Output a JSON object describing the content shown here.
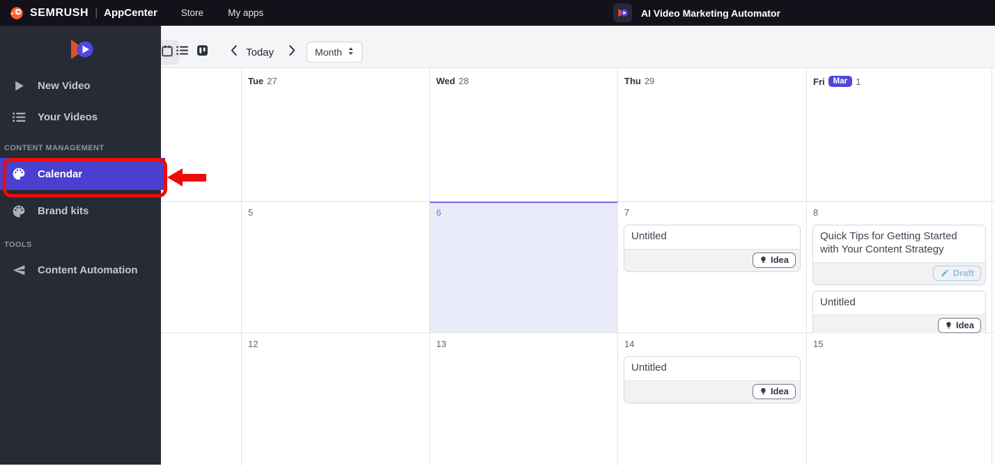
{
  "topbar": {
    "brand": "SEMRUSH",
    "divider": "|",
    "product": "AppCenter",
    "nav": [
      {
        "label": "Store"
      },
      {
        "label": "My apps"
      }
    ],
    "app_title": "AI Video Marketing Automator",
    "app_logo_icon": "video-play-logo-icon"
  },
  "sidebar": {
    "logo_icon": "video-play-logo-icon",
    "items": [
      {
        "label": "New Video",
        "icon": "play-icon"
      },
      {
        "label": "Your Videos",
        "icon": "list-icon"
      }
    ],
    "section_content_management": "CONTENT MANAGEMENT",
    "content_items": [
      {
        "label": "Calendar",
        "icon": "palette-icon",
        "active": true
      },
      {
        "label": "Brand kits",
        "icon": "palette-icon",
        "active": false
      }
    ],
    "section_tools": "TOOLS",
    "tools_items": [
      {
        "label": "Content Automation",
        "icon": "send-icon"
      }
    ]
  },
  "toolbar": {
    "view_icons": [
      "calendar-view-icon",
      "list-view-icon",
      "board-view-icon"
    ],
    "active_view": "calendar",
    "today_label": "Today",
    "view_selected": "Month"
  },
  "calendar": {
    "cells": {
      "r1c2": {
        "day_name": "Tue",
        "day_num": "27"
      },
      "r1c3": {
        "day_name": "Wed",
        "day_num": "28"
      },
      "r1c4": {
        "day_name": "Thu",
        "day_num": "29"
      },
      "r1c5": {
        "day_name": "Fri",
        "month_badge": "Mar",
        "day_num": "1"
      },
      "r2c2": {
        "day_num": "5"
      },
      "r2c3": {
        "day_num": "6",
        "selected": true
      },
      "r2c4": {
        "day_num": "7",
        "events": [
          {
            "title": "Untitled",
            "badge": "Idea"
          }
        ]
      },
      "r2c5": {
        "day_num": "8",
        "events": [
          {
            "title": "Quick Tips for Getting Started with Your Content Strategy",
            "badge": "Draft"
          },
          {
            "title": "Untitled",
            "badge": "Idea"
          }
        ]
      },
      "r3c2": {
        "day_num": "12"
      },
      "r3c3": {
        "day_num": "13"
      },
      "r3c4": {
        "day_num": "14",
        "events": [
          {
            "title": "Untitled",
            "badge": "Idea"
          }
        ]
      },
      "r3c5": {
        "day_num": "15"
      }
    }
  },
  "annotation": {
    "type": "highlight-box-with-arrow",
    "target": "Calendar sidebar item",
    "color": "#ee0b0b"
  },
  "colors": {
    "topbar_bg": "#13121a",
    "sidebar_bg": "#262b36",
    "accent_purple": "#4a40d0",
    "month_badge_purple": "#4f46d6",
    "selected_day_bg": "#e9ebf9",
    "draft_blue": "#8fc0d8",
    "logo_orange": "#e0512e",
    "logo_indigo": "#4f46e5",
    "annotation_red": "#ee0b0b"
  }
}
